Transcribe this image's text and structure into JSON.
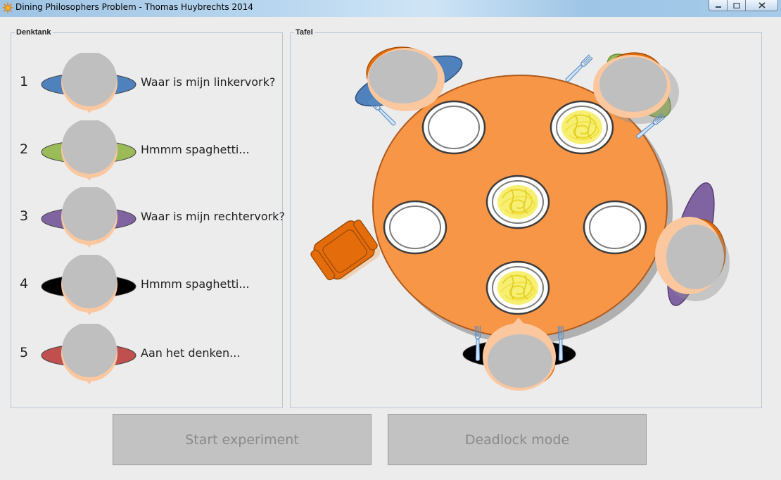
{
  "window": {
    "title": "Dining Philosophers Problem - Thomas Huybrechts 2014",
    "app_icon": "sun-icon",
    "controls": {
      "minimize": "minimize-icon",
      "maximize": "maximize-icon",
      "close": "close-icon"
    }
  },
  "denktank": {
    "title": "Denktank",
    "philosophers": [
      {
        "number": "1",
        "color": "#4f81bd",
        "status": "Waar is mijn linkervork?"
      },
      {
        "number": "2",
        "color": "#9bbb59",
        "status": "Hmmm spaghetti..."
      },
      {
        "number": "3",
        "color": "#8064a2",
        "status": "Waar is mijn rechtervork?"
      },
      {
        "number": "4",
        "color": "#000000",
        "status": "Hmmm spaghetti..."
      },
      {
        "number": "5",
        "color": "#c0504d",
        "status": "Aan het denken..."
      }
    ]
  },
  "tafel": {
    "title": "Tafel",
    "table_color": "#f79646",
    "empty_chair_color": "#e46c0a",
    "plates": [
      "empty",
      "spaghetti",
      "spaghetti",
      "empty",
      "empty",
      "spaghetti"
    ]
  },
  "buttons": {
    "start_label": "Start experiment",
    "deadlock_label": "Deadlock mode",
    "enabled": false
  }
}
